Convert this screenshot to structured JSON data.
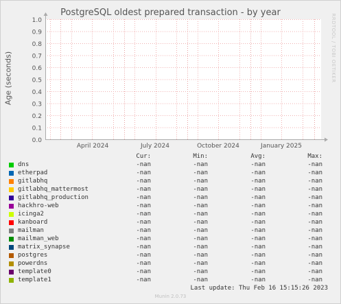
{
  "chart_data": {
    "type": "line",
    "title": "PostgreSQL oldest prepared transaction - by year",
    "ylabel": "Age (seconds)",
    "xlabel": "",
    "ylim": [
      0,
      1
    ],
    "yticks": [
      "0.0",
      "0.1",
      "0.2",
      "0.3",
      "0.4",
      "0.5",
      "0.6",
      "0.7",
      "0.8",
      "0.9",
      "1.0"
    ],
    "xticks": [
      "April 2024",
      "July 2024",
      "October 2024",
      "January 2025"
    ],
    "grid": true,
    "series": [
      {
        "name": "dns",
        "color": "#00cc00",
        "values": []
      },
      {
        "name": "etherpad",
        "color": "#0066b3",
        "values": []
      },
      {
        "name": "gitlabhq",
        "color": "#ff8000",
        "values": []
      },
      {
        "name": "gitlabhq_mattermost",
        "color": "#ffcc00",
        "values": []
      },
      {
        "name": "gitlabhq_production",
        "color": "#330099",
        "values": []
      },
      {
        "name": "hackhro-web",
        "color": "#990099",
        "values": []
      },
      {
        "name": "icinga2",
        "color": "#ccff00",
        "values": []
      },
      {
        "name": "kanboard",
        "color": "#ff0000",
        "values": []
      },
      {
        "name": "mailman",
        "color": "#808080",
        "values": []
      },
      {
        "name": "mailman_web",
        "color": "#008f00",
        "values": []
      },
      {
        "name": "matrix_synapse",
        "color": "#00487d",
        "values": []
      },
      {
        "name": "postgres",
        "color": "#b35a00",
        "values": []
      },
      {
        "name": "powerdns",
        "color": "#b38f00",
        "values": []
      },
      {
        "name": "template0",
        "color": "#6b006b",
        "values": []
      },
      {
        "name": "template1",
        "color": "#8fb300",
        "values": []
      }
    ]
  },
  "legend": {
    "headers": {
      "cur": "Cur:",
      "min": "Min:",
      "avg": "Avg:",
      "max": "Max:"
    },
    "rows": [
      {
        "name": "dns",
        "cur": "-nan",
        "min": "-nan",
        "avg": "-nan",
        "max": "-nan"
      },
      {
        "name": "etherpad",
        "cur": "-nan",
        "min": "-nan",
        "avg": "-nan",
        "max": "-nan"
      },
      {
        "name": "gitlabhq",
        "cur": "-nan",
        "min": "-nan",
        "avg": "-nan",
        "max": "-nan"
      },
      {
        "name": "gitlabhq_mattermost",
        "cur": "-nan",
        "min": "-nan",
        "avg": "-nan",
        "max": "-nan"
      },
      {
        "name": "gitlabhq_production",
        "cur": "-nan",
        "min": "-nan",
        "avg": "-nan",
        "max": "-nan"
      },
      {
        "name": "hackhro-web",
        "cur": "-nan",
        "min": "-nan",
        "avg": "-nan",
        "max": "-nan"
      },
      {
        "name": "icinga2",
        "cur": "-nan",
        "min": "-nan",
        "avg": "-nan",
        "max": "-nan"
      },
      {
        "name": "kanboard",
        "cur": "-nan",
        "min": "-nan",
        "avg": "-nan",
        "max": "-nan"
      },
      {
        "name": "mailman",
        "cur": "-nan",
        "min": "-nan",
        "avg": "-nan",
        "max": "-nan"
      },
      {
        "name": "mailman_web",
        "cur": "-nan",
        "min": "-nan",
        "avg": "-nan",
        "max": "-nan"
      },
      {
        "name": "matrix_synapse",
        "cur": "-nan",
        "min": "-nan",
        "avg": "-nan",
        "max": "-nan"
      },
      {
        "name": "postgres",
        "cur": "-nan",
        "min": "-nan",
        "avg": "-nan",
        "max": "-nan"
      },
      {
        "name": "powerdns",
        "cur": "-nan",
        "min": "-nan",
        "avg": "-nan",
        "max": "-nan"
      },
      {
        "name": "template0",
        "cur": "-nan",
        "min": "-nan",
        "avg": "-nan",
        "max": "-nan"
      },
      {
        "name": "template1",
        "cur": "-nan",
        "min": "-nan",
        "avg": "-nan",
        "max": "-nan"
      }
    ]
  },
  "last_update": "Last update: Thu Feb 16 15:15:26 2023",
  "watermark": "RRDTOOL / TOBI OETIKER",
  "footer": "Munin 2.0.73"
}
